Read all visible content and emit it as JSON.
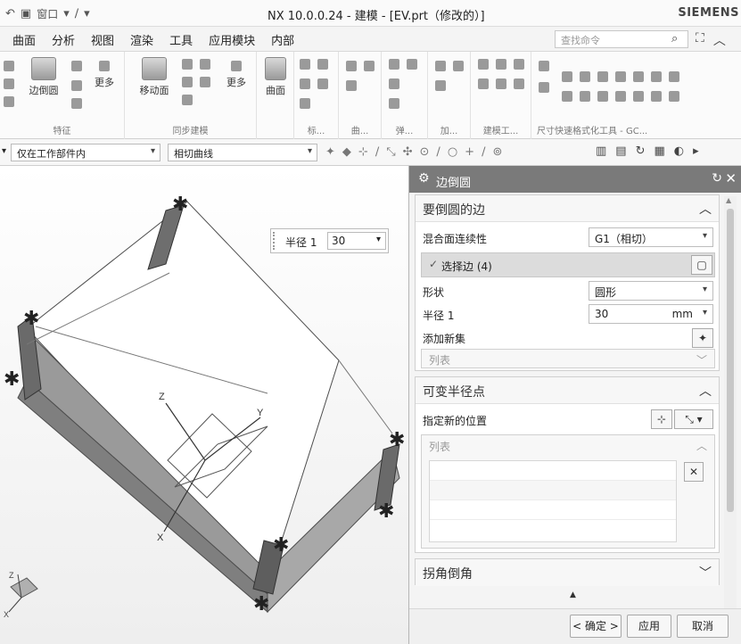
{
  "titlebar": {
    "window_menu": "窗口",
    "title": "NX 10.0.0.24 - 建模 - [EV.prt（修改的）]",
    "brand": "SIEMENS"
  },
  "menubar": {
    "items": [
      "曲面",
      "分析",
      "视图",
      "渲染",
      "工具",
      "应用模块",
      "内部"
    ],
    "command_search_placeholder": "查找命令"
  },
  "ribbon": {
    "groups": [
      {
        "label": "特征",
        "big_button": "边倒圆",
        "more": "更多"
      },
      {
        "label": "同步建模",
        "big_button": "移动面",
        "more": "更多"
      },
      {
        "label": "",
        "big_button": "曲面"
      },
      {
        "label": "标...",
        "small": ""
      },
      {
        "label": "曲...",
        "small": ""
      },
      {
        "label": "弹...",
        "small": ""
      },
      {
        "label": "加...",
        "small": ""
      },
      {
        "label": "建模工...",
        "small": ""
      },
      {
        "label": "尺寸快速格式化工具 - GC...",
        "small": ""
      }
    ]
  },
  "selection_bar": {
    "filter_value": "仅在工作部件内",
    "curve_rule": "相切曲线"
  },
  "viewport": {
    "radius_popup_label": "半径 1",
    "radius_popup_value": "30"
  },
  "dialog": {
    "title": "边倒圆",
    "section_edge": {
      "title": "要倒圆的边",
      "continuity_label": "混合面连续性",
      "continuity_value": "G1（相切）",
      "select_edge": "选择边 (4)",
      "shape_label": "形状",
      "shape_value": "圆形",
      "radius_label": "半径 1",
      "radius_value": "30",
      "radius_unit": "mm",
      "add_new_set": "添加新集",
      "list_label": "列表"
    },
    "section_variable": {
      "title": "可变半径点",
      "specify_location": "指定新的位置",
      "list_label": "列表"
    },
    "section_corner": {
      "title": "拐角倒角"
    },
    "buttons": {
      "ok": "< 确定 >",
      "apply": "应用",
      "cancel": "取消"
    }
  }
}
